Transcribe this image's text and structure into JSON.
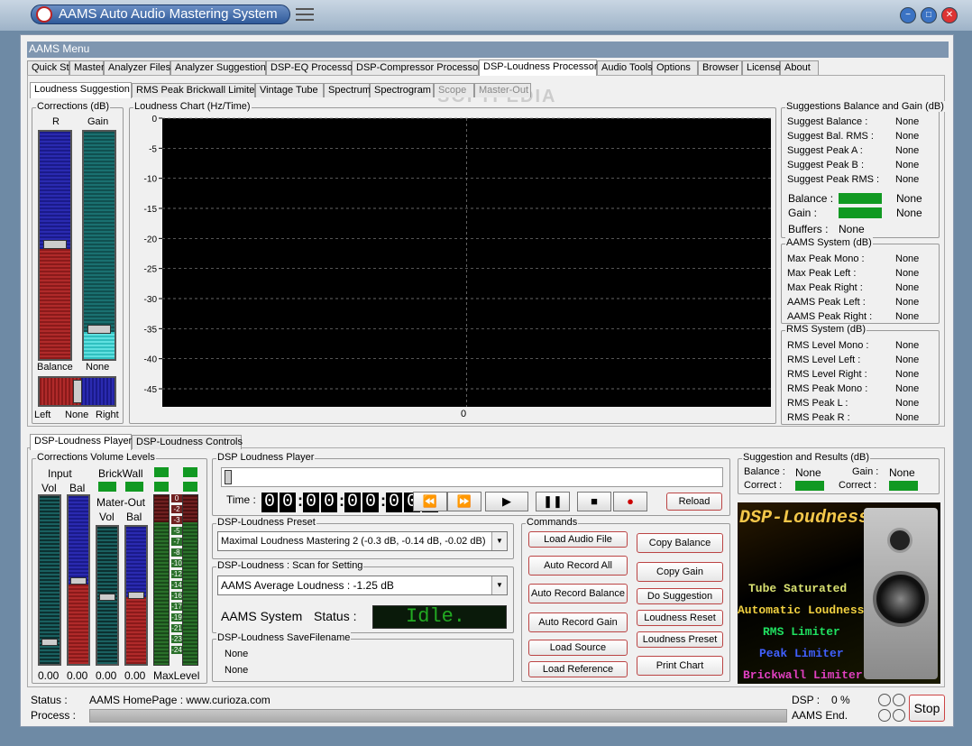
{
  "window": {
    "title": "AAMS Auto Audio Mastering System",
    "menu_title": "AAMS Menu"
  },
  "main_tabs": [
    "Quick Start",
    "Master",
    "Analyzer Files",
    "Analyzer Suggestion",
    "DSP-EQ Processor",
    "DSP-Compressor Processor",
    "DSP-Loudness Processor",
    "Audio Tools",
    "Options",
    "Browser",
    "License",
    "About"
  ],
  "sub_tabs": [
    "Loudness Suggestion",
    "RMS Peak Brickwall Limiter",
    "Vintage Tube",
    "Spectrum",
    "Spectrogram",
    "Scope",
    "Master-Out"
  ],
  "watermark": "SOFTPEDIA",
  "corrections": {
    "title": "Corrections (dB)",
    "r_label": "R",
    "gain_label": "Gain",
    "balance_label": "Balance",
    "none_label": "None",
    "left": "Left",
    "none": "None",
    "right": "Right"
  },
  "chart": {
    "title": "Loudness Chart (Hz/Time)",
    "x_tick": "0"
  },
  "chart_data": {
    "type": "line",
    "title": "Loudness Chart (Hz/Time)",
    "y_ticks": [
      "0",
      "-5",
      "-10",
      "-15",
      "-20",
      "-25",
      "-30",
      "-35",
      "-40",
      "-45"
    ],
    "ylim": [
      -48,
      0
    ],
    "x_ticks": [
      "0"
    ],
    "series": [],
    "grid": true
  },
  "suggestions": {
    "title": "Suggestions Balance and Gain (dB)",
    "rows": [
      {
        "k": "Suggest Balance :",
        "v": "None"
      },
      {
        "k": "Suggest Bal. RMS :",
        "v": "None"
      },
      {
        "k": "Suggest Peak A :",
        "v": "None"
      },
      {
        "k": "Suggest Peak B :",
        "v": "None"
      },
      {
        "k": "Suggest Peak RMS :",
        "v": "None"
      }
    ],
    "balance": "Balance :",
    "balance_v": "None",
    "gain": "Gain :",
    "gain_v": "None",
    "buffers": "Buffers :",
    "buffers_v": "None"
  },
  "aams_system": {
    "title": "AAMS System (dB)",
    "rows": [
      {
        "k": "Max Peak Mono :",
        "v": "None"
      },
      {
        "k": "Max Peak  Left :",
        "v": "None"
      },
      {
        "k": "Max Peak  Right :",
        "v": "None"
      },
      {
        "k": "AAMS Peak Left :",
        "v": "None"
      },
      {
        "k": "AAMS Peak Right :",
        "v": "None"
      }
    ]
  },
  "rms_system": {
    "title": "RMS System (dB)",
    "rows": [
      {
        "k": "RMS Level Mono :",
        "v": "None"
      },
      {
        "k": "RMS Level Left :",
        "v": "None"
      },
      {
        "k": "RMS Level Right :",
        "v": "None"
      },
      {
        "k": "RMS Peak Mono :",
        "v": "None"
      },
      {
        "k": "RMS Peak L :",
        "v": "None"
      },
      {
        "k": "RMS Peak R :",
        "v": "None"
      }
    ]
  },
  "bottom_tabs": [
    "DSP-Loudness Player",
    "DSP-Loudness Controls"
  ],
  "volume": {
    "title": "Corrections Volume Levels",
    "input": "Input",
    "brickwall": "BrickWall",
    "vol": "Vol",
    "bal": "Bal",
    "mater_out": "Mater-Out",
    "vol2": "Vol",
    "bal2": "Bal",
    "values": [
      "0.00",
      "0.00",
      "0.00",
      "0.00"
    ],
    "max_level": "MaxLevel",
    "scale": [
      "0",
      "-2",
      "-3",
      "-5",
      "-7",
      "-8",
      "-10",
      "-12",
      "-14",
      "-16",
      "-17",
      "-19",
      "-21",
      "-23",
      "-24"
    ]
  },
  "player": {
    "title": "DSP Loudness Player",
    "time_label": "Time :",
    "time_digits": [
      "0",
      "0",
      "0",
      "0",
      "0",
      "0",
      "0",
      "0",
      "0"
    ],
    "reload": "Reload",
    "transport": [
      "rewind-icon",
      "fast-forward-icon",
      "play-icon",
      "pause-icon",
      "stop-icon",
      "record-icon"
    ]
  },
  "preset": {
    "title": "DSP-Loudness Preset",
    "value": "Maximal Loudness Mastering  2  (-0.3 dB, -0.14 dB, -0.02 dB)"
  },
  "scan": {
    "title": "DSP-Loudness : Scan for Setting",
    "value": "AAMS Average Loudness : -1.25 dB",
    "system_label": "AAMS System",
    "status_label": "Status :",
    "status_value": "Idle."
  },
  "savefile": {
    "title": "DSP-Loudness SaveFilename",
    "line1": "None",
    "line2": "None"
  },
  "commands": {
    "title": "Commands",
    "buttons": [
      "Load Audio File",
      "Copy Balance",
      "Auto Record All",
      "Copy Gain",
      "Auto Record Balance",
      "Do Suggestion",
      "Auto Record Gain",
      "Loudness Reset",
      "Load Source",
      "Loudness Preset",
      "Load Reference",
      "Print Chart"
    ]
  },
  "results": {
    "title": "Suggestion and Results (dB)",
    "balance": "Balance :",
    "balance_v": "None",
    "gain": "Gain :",
    "gain_v": "None",
    "correct1": "Correct :",
    "correct2": "Correct :"
  },
  "banner": {
    "title": "DSP-Loudness",
    "lines": [
      "Tube Saturated",
      "Automatic Loudness",
      "RMS Limiter",
      "Peak Limiter",
      "Brickwall Limiter"
    ]
  },
  "statusbar": {
    "status_label": "Status :",
    "homepage": "AAMS HomePage : www.curioza.com",
    "dsp_label": "DSP :",
    "dsp_value": "0 %",
    "process_label": "Process :",
    "end_label": "AAMS End.",
    "stop": "Stop"
  },
  "colors": {
    "titlebar": "#9eb3c8",
    "accent_green": "#119922",
    "chart_bg": "#000000"
  }
}
